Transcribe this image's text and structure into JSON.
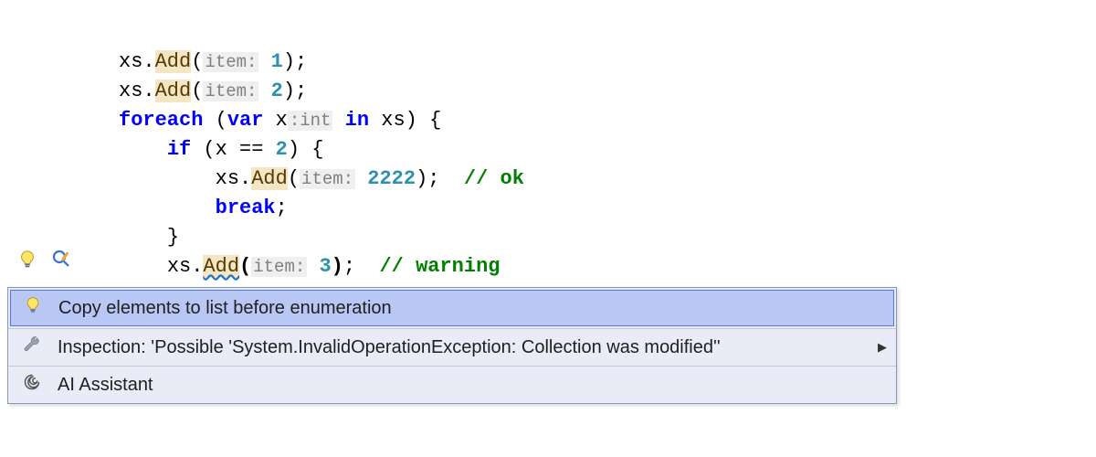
{
  "code": {
    "l1": {
      "obj": "xs",
      "dot": ".",
      "method": "Add",
      "open": "(",
      "hint_prefix": "item:",
      "sp": " ",
      "num": "1",
      "close": ")",
      "semi": ";"
    },
    "l2": {
      "obj": "xs",
      "dot": ".",
      "method": "Add",
      "open": "(",
      "hint_prefix": "item:",
      "sp": " ",
      "num": "2",
      "close": ")",
      "semi": ";"
    },
    "l3": {
      "kw_foreach": "foreach",
      "sp1": " ",
      "open": "(",
      "kw_var": "var",
      "sp2": " ",
      "x": "x",
      "thint": ":int",
      "sp3": " ",
      "kw_in": "in",
      "sp4": " ",
      "xs": "xs",
      "close": ")",
      "sp5": " ",
      "brace": "{"
    },
    "l4": {
      "kw_if": "if",
      "sp1": " ",
      "open": "(",
      "x": "x",
      "sp2": " ",
      "eq": "==",
      "sp3": " ",
      "num": "2",
      "close": ")",
      "sp4": " ",
      "brace": "{"
    },
    "l5": {
      "obj": "xs",
      "dot": ".",
      "method": "Add",
      "open": "(",
      "hint_prefix": "item:",
      "sp": " ",
      "num": "2222",
      "close": ")",
      "semi": ";",
      "sp2": "  ",
      "comment": "// ok"
    },
    "l6": {
      "kw_break": "break",
      "semi": ";"
    },
    "l7": {
      "brace": "}"
    },
    "l8": {
      "obj": "xs",
      "dot": ".",
      "method": "Add",
      "open": "(",
      "hint_prefix": "item:",
      "sp": " ",
      "num": "3",
      "close": ")",
      "semi": ";",
      "sp2": "  ",
      "comment": "// warning"
    }
  },
  "popup": {
    "item1": "Copy elements to list before enumeration",
    "item2": "Inspection: 'Possible 'System.InvalidOperationException: Collection was modified''",
    "item3": "AI Assistant"
  }
}
